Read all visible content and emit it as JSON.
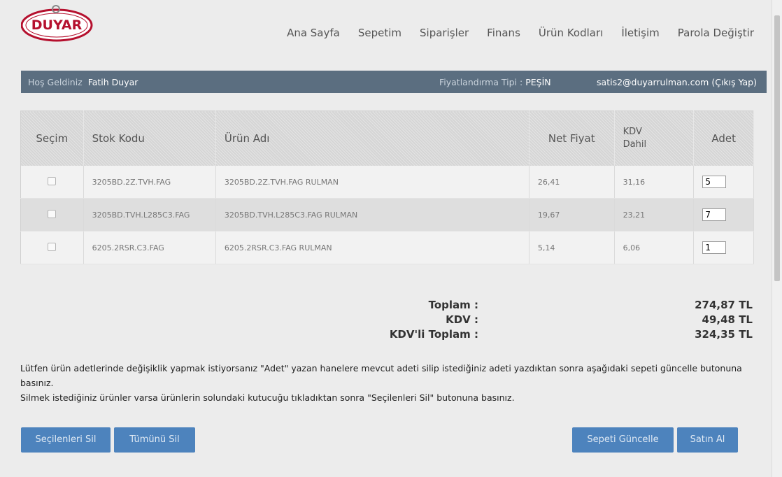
{
  "logo": {
    "text": "DUYAR"
  },
  "nav": {
    "items": [
      "Ana Sayfa",
      "Sepetim",
      "Siparişler",
      "Finans",
      "Ürün Kodları",
      "İletişim",
      "Parola Değiştir"
    ]
  },
  "infobar": {
    "welcome_label": "Hoş Geldiniz",
    "user_name": "Fatih Duyar",
    "pricing_label": "Fiyatlandırma Tipi :",
    "pricing_value": "PEŞİN",
    "account": "satis2@duyarrulman.com (Çıkış Yap)"
  },
  "table": {
    "headers": {
      "select": "Seçim",
      "stock_code": "Stok Kodu",
      "product_name": "Ürün Adı",
      "net_price": "Net Fiyat",
      "vat_incl_1": "KDV",
      "vat_incl_2": "Dahil",
      "quantity": "Adet"
    },
    "rows": [
      {
        "stock_code": "3205BD.2Z.TVH.FAG",
        "product_name": "3205BD.2Z.TVH.FAG RULMAN",
        "net_price": "26,41",
        "vat_incl": "31,16",
        "quantity": "5",
        "checked": false
      },
      {
        "stock_code": "3205BD.TVH.L285C3.FAG",
        "product_name": "3205BD.TVH.L285C3.FAG RULMAN",
        "net_price": "19,67",
        "vat_incl": "23,21",
        "quantity": "7",
        "checked": false
      },
      {
        "stock_code": "6205.2RSR.C3.FAG",
        "product_name": "6205.2RSR.C3.FAG RULMAN",
        "net_price": "5,14",
        "vat_incl": "6,06",
        "quantity": "1",
        "checked": false
      }
    ]
  },
  "totals": {
    "subtotal_label": "Toplam :",
    "subtotal_value": "274,87 TL",
    "vat_label": "KDV :",
    "vat_value": "49,48 TL",
    "total_label": "KDV'li Toplam :",
    "total_value": "324,35 TL"
  },
  "note": {
    "line1": "Lütfen ürün adetlerinde değişiklik yapmak istiyorsanız \"Adet\" yazan hanelere mevcut adeti silip istediğiniz adeti yazdıktan sonra aşağıdaki sepeti güncelle butonuna basınız.",
    "line2": "Silmek istediğiniz ürünler varsa ürünlerin solundaki kutucuğu tıkladıktan sonra \"Seçilenleri Sil\" butonuna basınız."
  },
  "buttons": {
    "delete_selected": "Seçilenleri Sil",
    "delete_all": "Tümünü Sil",
    "update_cart": "Sepeti Güncelle",
    "buy": "Satın Al"
  },
  "colors": {
    "infobar_bg": "#5b6e80",
    "button_bg": "#4d83bd",
    "logo_red": "#b5102e"
  }
}
